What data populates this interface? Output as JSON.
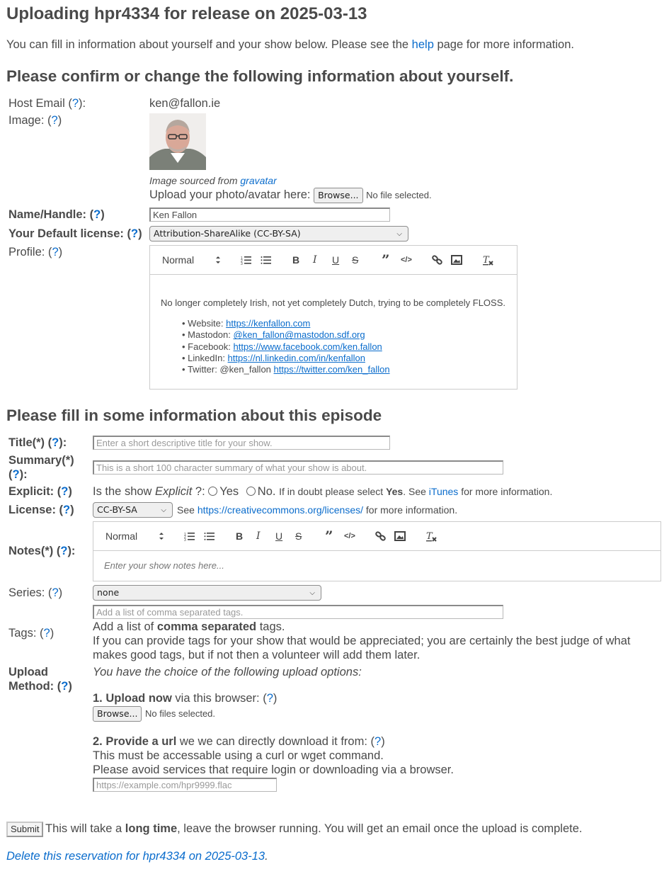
{
  "page": {
    "title": "Uploading hpr4334 for release on 2025-03-13",
    "intro_before": "You can fill in information about yourself and your show below. Please see the ",
    "intro_link": "help",
    "intro_after": " page for more information."
  },
  "host_section": {
    "heading": "Please confirm or change the following information about yourself.",
    "email": {
      "label": "Host Email (",
      "help": "?",
      "suffix": "):",
      "value": "ken@fallon.ie"
    },
    "image": {
      "label": "Image: (",
      "help": "?",
      "suffix": ")",
      "sourced_text": "Image sourced from ",
      "sourced_link": "gravatar",
      "upload_label": "Upload your photo/avatar here:",
      "browse_label": "Browse...",
      "file_status": "No file selected."
    },
    "name": {
      "label": "Name/Handle: (",
      "help": "?",
      "suffix": ")",
      "value": "Ken Fallon"
    },
    "default_license": {
      "label": "Your Default license: (",
      "help": "?",
      "suffix": ")",
      "value": "Attribution-ShareAlike (CC-BY-SA)"
    },
    "profile": {
      "label": "Profile: (",
      "help": "?",
      "suffix": ")",
      "toolbar": {
        "format": "Normal"
      },
      "intro": "No longer completely Irish, not yet completely Dutch, trying to be completely FLOSS.",
      "links": [
        {
          "label": "Website: ",
          "link": "https://kenfallon.com"
        },
        {
          "label": "Mastodon: ",
          "link": "@ken_fallon@mastodon.sdf.org"
        },
        {
          "label": "Facebook: ",
          "link": "https://www.facebook.com/ken.fallon"
        },
        {
          "label": "LinkedIn: ",
          "link": "https://nl.linkedin.com/in/kenfallon"
        },
        {
          "label": "Twitter: @ken_fallon ",
          "link": "https://twitter.com/ken_fallon"
        }
      ]
    }
  },
  "episode_section": {
    "heading": "Please fill in some information about this episode",
    "title": {
      "label": "Title(*) (",
      "help": "?",
      "suffix": "):",
      "value": "",
      "placeholder": "Enter a short descriptive title for your show."
    },
    "summary": {
      "label": "Summary(*)",
      "label2": "(",
      "help": "?",
      "suffix": "):",
      "value": "",
      "placeholder": "This is a short 100 character summary of what your show is about."
    },
    "explicit": {
      "label": "Explicit: (",
      "help": "?",
      "suffix": ")",
      "question_before": "Is the show ",
      "question_em": "Explicit",
      "question_after": " ?:",
      "yes": "Yes",
      "no": "No.",
      "hint_before": "If in doubt please select ",
      "hint_bold": "Yes",
      "hint_mid": ". See ",
      "hint_link": "iTunes",
      "hint_after": " for more information."
    },
    "license": {
      "label": "License: (",
      "help": "?",
      "suffix": ")",
      "value": "CC-BY-SA",
      "see": "See ",
      "link": "https://creativecommons.org/licenses/",
      "after": " for more information."
    },
    "notes": {
      "label": "Notes(*) (",
      "help": "?",
      "suffix": "):",
      "format": "Normal",
      "placeholder": "Enter your show notes here..."
    },
    "series": {
      "label": "Series: (",
      "help": "?",
      "suffix": ")",
      "value": "none"
    },
    "tags": {
      "label": "Tags: (",
      "help": "?",
      "suffix": ")",
      "placeholder": "Add a list of comma separated tags.",
      "hint_before": "Add a list of ",
      "hint_bold": "comma separated",
      "hint_after": " tags.",
      "hint2": "If you can provide tags for your show that would be appreciated; you are certainly the best judge of what makes good tags, but if not then a volunteer will add them later."
    },
    "upload": {
      "label1": "Upload",
      "label2": "Method: (",
      "help": "?",
      "suffix": ")",
      "intro": "You have the choice of the following upload options:",
      "opt1_bold": "1. Upload now",
      "opt1_rest": " via this browser: (",
      "opt1_help": "?",
      "opt1_suffix": ")",
      "browse_label": "Browse...",
      "file_status": "No files selected.",
      "opt2_bold": "2. Provide a url",
      "opt2_rest": " we we can directly download it from: (",
      "opt2_help": "?",
      "opt2_suffix": ")",
      "opt2_line1": "This must be accessable using a curl or wget command.",
      "opt2_line2": "Please avoid services that require login or downloading via a browser.",
      "url_placeholder": "https://example.com/hpr9999.flac"
    }
  },
  "footer": {
    "submit_label": "Submit",
    "note_before": " This will take a ",
    "note_bold": "long time",
    "note_after": ", leave the browser running. You will get an email once the upload is complete.",
    "delete_link": "Delete this reservation for hpr4334 on 2025-03-13",
    "delete_after": "."
  },
  "colors": {
    "text": "#4a4a4a",
    "link": "#0a6ccc",
    "border": "#cccccc"
  }
}
